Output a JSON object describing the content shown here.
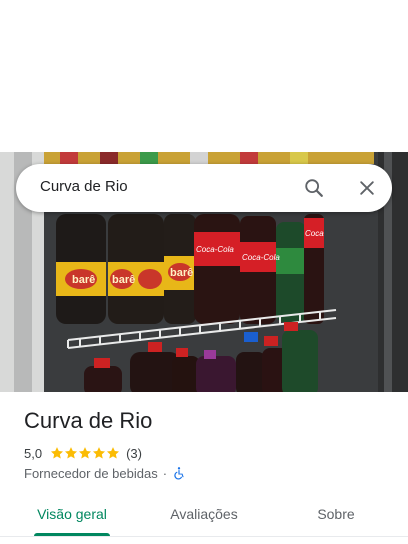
{
  "search": {
    "query": "Curva de Rio",
    "search_icon": "search-icon",
    "close_icon": "close-icon"
  },
  "place": {
    "name": "Curva de Rio",
    "rating": "5,0",
    "stars": 5,
    "review_count": "(3)",
    "category": "Fornecedor de bebidas",
    "separator": "·",
    "accessibility_icon": "wheelchair-icon"
  },
  "photo": {
    "labels": [
      "barê",
      "barê",
      "barê",
      "Coca-Cola",
      "Coca-Cola",
      "Coca"
    ]
  },
  "tabs": [
    {
      "label": "Visão geral",
      "active": true
    },
    {
      "label": "Avaliações",
      "active": false
    },
    {
      "label": "Sobre",
      "active": false
    }
  ],
  "colors": {
    "accent": "#01875f",
    "star": "#fbbc04",
    "access": "#1a73e8"
  }
}
